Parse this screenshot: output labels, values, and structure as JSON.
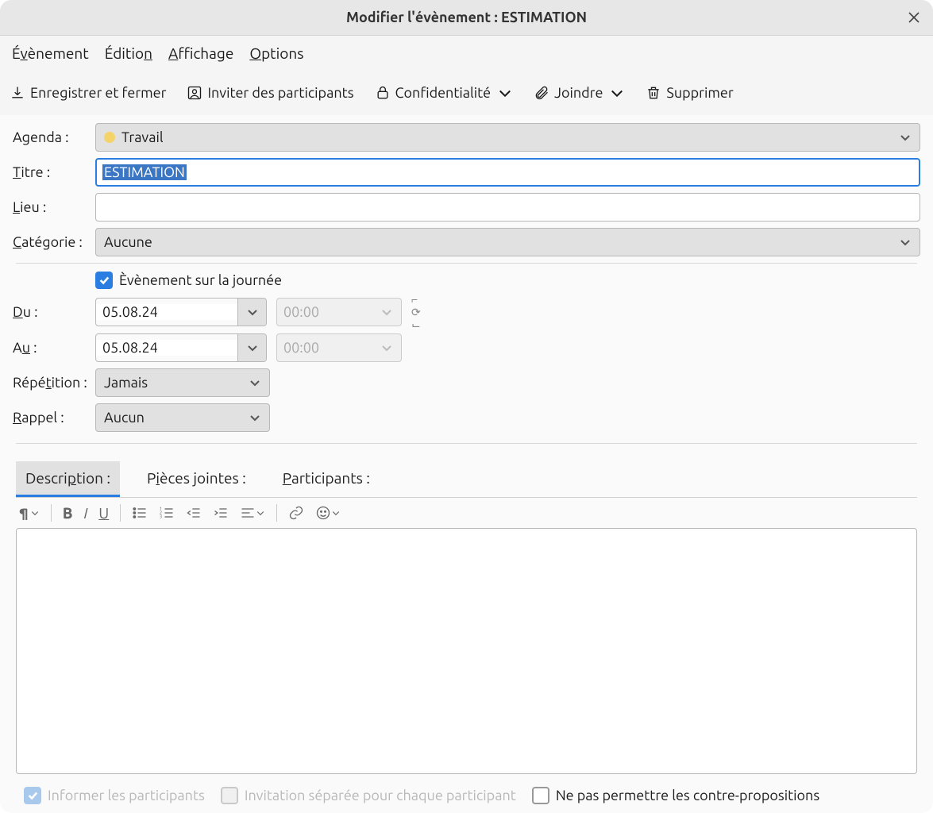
{
  "window": {
    "title": "Modifier l'évènement : ESTIMATION"
  },
  "menubar": {
    "event": {
      "pre": "É",
      "u": "v",
      "post": "ènement"
    },
    "edition": {
      "pre": "Éditio",
      "u": "n",
      "post": ""
    },
    "display": {
      "pre": "",
      "u": "A",
      "post": "ffichage"
    },
    "options": {
      "pre": "",
      "u": "O",
      "post": "ptions"
    }
  },
  "toolbar": {
    "save_close": "Enregistrer et fermer",
    "invite": "Inviter des participants",
    "privacy": "Confidentialité",
    "attach": "Joindre",
    "delete": "Supprimer"
  },
  "labels": {
    "agenda": "Agenda :",
    "title": {
      "pre": "",
      "u": "T",
      "post": "itre :"
    },
    "location": {
      "pre": "",
      "u": "L",
      "post": "ieu :"
    },
    "category": {
      "pre": "",
      "u": "C",
      "post": "atégorie :"
    },
    "allday": {
      "pre": "È",
      "u": "v",
      "post": "ènement sur la journée"
    },
    "from": {
      "pre": "",
      "u": "D",
      "post": "u :"
    },
    "to": {
      "pre": "A",
      "u": "u",
      "post": " :"
    },
    "repeat": {
      "pre": "Répé",
      "u": "t",
      "post": "ition :"
    },
    "reminder": {
      "pre": "",
      "u": "R",
      "post": "appel :"
    }
  },
  "values": {
    "agenda": "Travail",
    "agenda_color": "#f4d46a",
    "title": "ESTIMATION",
    "location": "",
    "category": "Aucune",
    "allday_checked": true,
    "date_from": "05.08.24",
    "date_to": "05.08.24",
    "time_from": "00:00",
    "time_to": "00:00",
    "repeat": "Jamais",
    "reminder": "Aucun"
  },
  "tabs": {
    "description": {
      "pre": "Descri",
      "u": "p",
      "post": "tion :"
    },
    "attachments": {
      "pre": "P",
      "u": "i",
      "post": "èces jointes :"
    },
    "participants": {
      "pre": "",
      "u": "P",
      "post": "articipants :"
    }
  },
  "footer": {
    "notify": {
      "pre": "In",
      "u": "f",
      "post": "ormer les participants"
    },
    "separate": {
      "pre": "",
      "u": "I",
      "post": "nvitation séparée pour chaque participant"
    },
    "nocounter": {
      "pre": "Ne p",
      "u": "a",
      "post": "s permettre les contre-propositions"
    }
  }
}
